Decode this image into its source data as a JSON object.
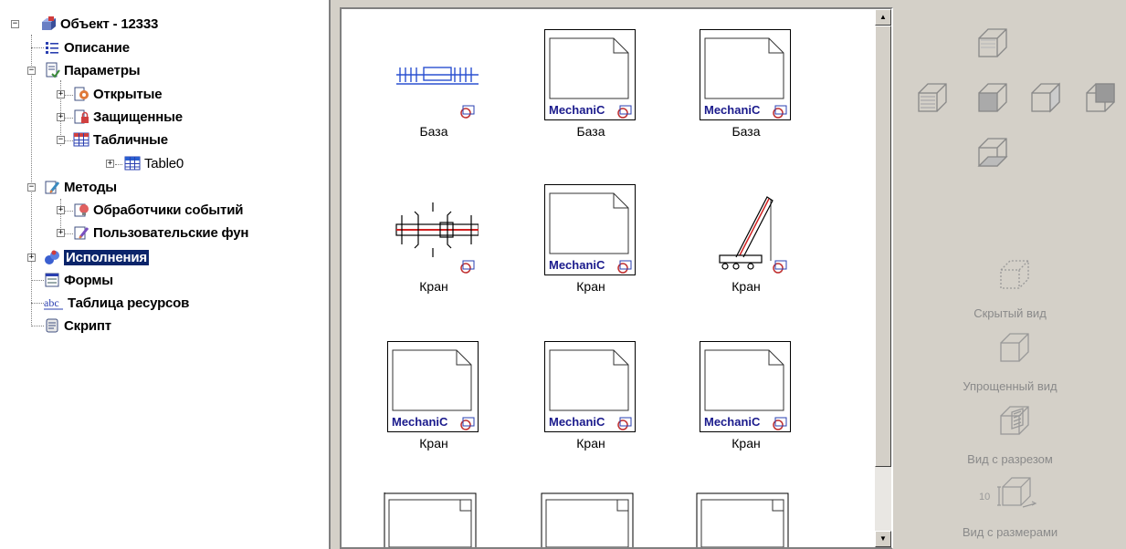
{
  "tree": {
    "root": "Объект - 12333",
    "description": "Описание",
    "parameters": "Параметры",
    "open": "Открытые",
    "protected": "Защищенные",
    "tabular": "Табличные",
    "table0": "Table0",
    "methods": "Методы",
    "event_handlers": "Обработчики событий",
    "user_functions": "Пользовательские фун",
    "executions": "Исполнения",
    "forms": "Формы",
    "resource_table": "Таблица ресурсов",
    "script": "Скрипт"
  },
  "gallery": {
    "thumb_text": "MechaniC",
    "items": [
      {
        "label": "База",
        "kind": "base-schematic"
      },
      {
        "label": "База",
        "kind": "mechanic-page"
      },
      {
        "label": "База",
        "kind": "mechanic-page"
      },
      {
        "label": "Кран",
        "kind": "crane-top"
      },
      {
        "label": "Кран",
        "kind": "mechanic-page"
      },
      {
        "label": "Кран",
        "kind": "crane-side"
      },
      {
        "label": "Кран",
        "kind": "mechanic-page"
      },
      {
        "label": "Кран",
        "kind": "mechanic-page"
      },
      {
        "label": "Кран",
        "kind": "mechanic-page"
      }
    ]
  },
  "views": {
    "hidden": "Скрытый вид",
    "simplified": "Упрощенный вид",
    "section": "Вид с разрезом",
    "dimensions": "Вид с размерами",
    "dim_text": "10"
  },
  "colors": {
    "selection": "#0a246a",
    "brand_text": "#1a1a8c",
    "disabled_text": "#8a8a8a"
  }
}
